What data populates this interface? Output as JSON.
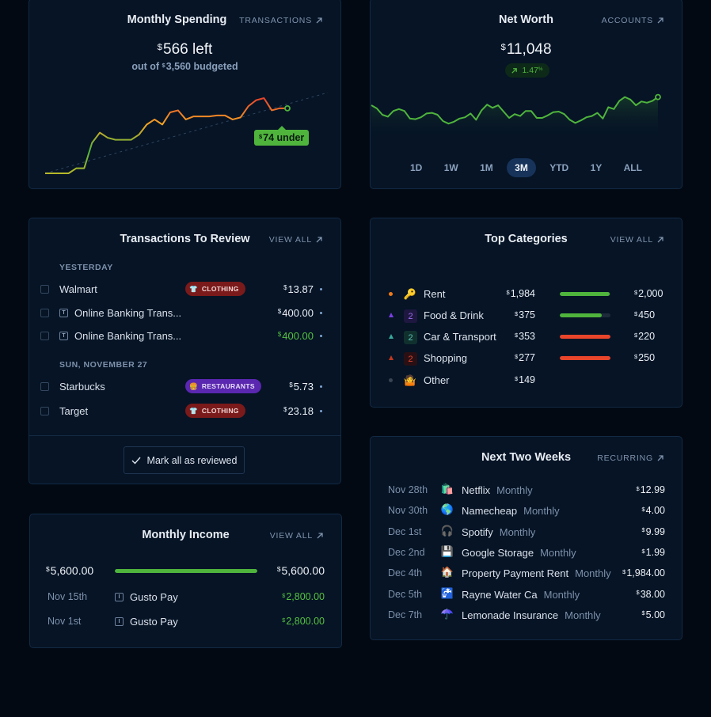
{
  "colors": {
    "background": "#030913",
    "card": "#061426",
    "green": "#4fb43c",
    "orange": "#f07a1a",
    "red": "#e8452b",
    "purple": "#7b3fe4",
    "teal": "#3aa89a"
  },
  "monthly_spending": {
    "title": "Monthly Spending",
    "link_label": "TRANSACTIONS",
    "left_currency": "$",
    "left_amount": "566 left",
    "sub_prefix": "out of",
    "sub_currency": "$",
    "sub_amount": "3,560 budgeted",
    "tooltip_currency": "$",
    "tooltip_text": "74 under",
    "chart_values": [
      0,
      0,
      0,
      0,
      0.05,
      0.05,
      0.3,
      0.4,
      0.35,
      0.33,
      0.33,
      0.33,
      0.38,
      0.48,
      0.53,
      0.48,
      0.6,
      0.62,
      0.53,
      0.56,
      0.56,
      0.56,
      0.57,
      0.57,
      0.53,
      0.55,
      0.66,
      0.72,
      0.74,
      0.62,
      0.64,
      0.64
    ],
    "budget_line": [
      0,
      1
    ]
  },
  "net_worth": {
    "title": "Net Worth",
    "link_label": "ACCOUNTS",
    "currency": "$",
    "amount": "11,048",
    "change": "1.47",
    "change_unit": "%",
    "chart_values": [
      0.55,
      0.5,
      0.4,
      0.37,
      0.46,
      0.49,
      0.46,
      0.34,
      0.33,
      0.36,
      0.42,
      0.43,
      0.4,
      0.3,
      0.26,
      0.29,
      0.34,
      0.36,
      0.42,
      0.32,
      0.47,
      0.56,
      0.51,
      0.55,
      0.45,
      0.35,
      0.41,
      0.38,
      0.46,
      0.46,
      0.35,
      0.35,
      0.39,
      0.44,
      0.45,
      0.41,
      0.32,
      0.27,
      0.31,
      0.36,
      0.38,
      0.43,
      0.34,
      0.52,
      0.49,
      0.62,
      0.68,
      0.64,
      0.55,
      0.61,
      0.59,
      0.62,
      0.68
    ],
    "ranges": [
      "1D",
      "1W",
      "1M",
      "3M",
      "YTD",
      "1Y",
      "ALL"
    ],
    "active_range": "3M"
  },
  "transactions_review": {
    "title": "Transactions To Review",
    "link_label": "VIEW ALL",
    "groups": [
      {
        "label": "YESTERDAY",
        "items": [
          {
            "name": "Walmart",
            "icon": "",
            "tag": "CLOTHING",
            "tag_emoji": "👕",
            "currency": "$",
            "amount": "13.87",
            "positive": false
          },
          {
            "name": "Online Banking Trans...",
            "icon": "T",
            "tag": "",
            "tag_emoji": "",
            "currency": "$",
            "amount": "400.00",
            "positive": false
          },
          {
            "name": "Online Banking Trans...",
            "icon": "T",
            "tag": "",
            "tag_emoji": "",
            "currency": "$",
            "amount": "400.00",
            "positive": true
          }
        ]
      },
      {
        "label": "SUN, NOVEMBER 27",
        "items": [
          {
            "name": "Starbucks",
            "icon": "",
            "tag": "RESTAURANTS",
            "tag_emoji": "🍔",
            "currency": "$",
            "amount": "5.73",
            "positive": false
          },
          {
            "name": "Target",
            "icon": "",
            "tag": "CLOTHING",
            "tag_emoji": "👕",
            "currency": "$",
            "amount": "23.18",
            "positive": false
          }
        ]
      }
    ],
    "mark_all_label": "Mark all as reviewed"
  },
  "top_categories": {
    "title": "Top Categories",
    "link_label": "VIEW ALL",
    "items": [
      {
        "marker": "dot",
        "marker_color": "#f07a1a",
        "emoji": "🔑",
        "count": "",
        "name": "Rent",
        "spent": "1,984",
        "budget": "2,000",
        "progress": 0.99,
        "bar_color": "#4fb43c"
      },
      {
        "marker": "triangle",
        "marker_color": "#7b3fe4",
        "emoji": "",
        "count": "2",
        "count_bg": "#1e1740",
        "count_color": "#9b6cf0",
        "name": "Food & Drink",
        "spent": "375",
        "budget": "450",
        "progress": 0.83,
        "bar_color": "#4fb43c"
      },
      {
        "marker": "triangle",
        "marker_color": "#3aa89a",
        "emoji": "",
        "count": "2",
        "count_bg": "#10302e",
        "count_color": "#5ac0b2",
        "name": "Car & Transport",
        "spent": "353",
        "budget": "220",
        "progress": 1.0,
        "bar_color": "#e8452b"
      },
      {
        "marker": "triangle",
        "marker_color": "#c2381f",
        "emoji": "",
        "count": "2",
        "count_bg": "#2a1014",
        "count_color": "#e2452f",
        "name": "Shopping",
        "spent": "277",
        "budget": "250",
        "progress": 1.0,
        "bar_color": "#e8452b"
      },
      {
        "marker": "dot",
        "marker_color": "#3a4452",
        "emoji": "🤷",
        "count": "",
        "name": "Other",
        "spent": "149",
        "budget": "",
        "progress": null,
        "bar_color": ""
      }
    ]
  },
  "monthly_income": {
    "title": "Monthly Income",
    "link_label": "VIEW ALL",
    "received": "5,600.00",
    "expected": "5,600.00",
    "progress": 1.0,
    "items": [
      {
        "date": "Nov 15th",
        "icon": "I",
        "name": "Gusto Pay",
        "amount": "2,800.00"
      },
      {
        "date": "Nov 1st",
        "icon": "I",
        "name": "Gusto Pay",
        "amount": "2,800.00"
      }
    ]
  },
  "next_two_weeks": {
    "title": "Next Two Weeks",
    "link_label": "RECURRING",
    "items": [
      {
        "date": "Nov 28th",
        "emoji": "🛍️",
        "name": "Netflix",
        "frequency": "Monthly",
        "amount": "12.99"
      },
      {
        "date": "Nov 30th",
        "emoji": "🌎",
        "name": "Namecheap",
        "frequency": "Monthly",
        "amount": "4.00"
      },
      {
        "date": "Dec 1st",
        "emoji": "🎧",
        "name": "Spotify",
        "frequency": "Monthly",
        "amount": "9.99"
      },
      {
        "date": "Dec 2nd",
        "emoji": "💾",
        "name": "Google Storage",
        "frequency": "Monthly",
        "amount": "1.99"
      },
      {
        "date": "Dec 4th",
        "emoji": "🏠",
        "name": "Property Payment Rent",
        "frequency": "Monthly",
        "amount": "1,984.00"
      },
      {
        "date": "Dec 5th",
        "emoji": "🚰",
        "name": "Rayne Water Ca",
        "frequency": "Monthly",
        "amount": "38.00"
      },
      {
        "date": "Dec 7th",
        "emoji": "☂️",
        "name": "Lemonade Insurance",
        "frequency": "Monthly",
        "amount": "5.00"
      }
    ]
  }
}
